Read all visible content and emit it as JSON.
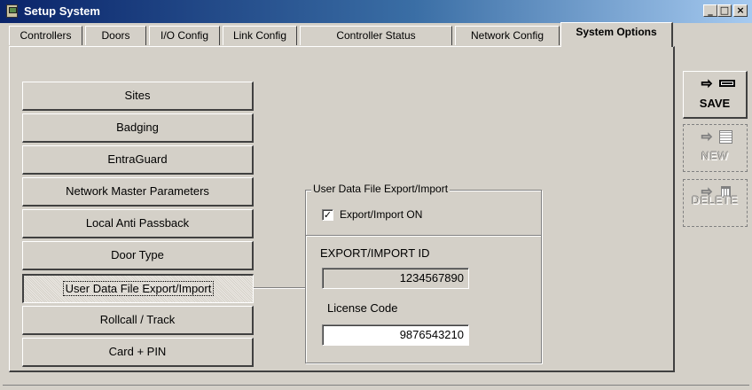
{
  "window": {
    "title": "Setup System",
    "controls": {
      "minimize": "_",
      "maximize": "□",
      "close": "×"
    }
  },
  "tabs": [
    {
      "label": "Controllers",
      "active": false
    },
    {
      "label": "Doors",
      "active": false
    },
    {
      "label": "I/O Config",
      "active": false
    },
    {
      "label": "Link Config",
      "active": false
    },
    {
      "label": "Controller Status",
      "active": false
    },
    {
      "label": "Network Config",
      "active": false
    },
    {
      "label": "System Options",
      "active": true
    }
  ],
  "options": [
    {
      "label": "Sites"
    },
    {
      "label": "Badging"
    },
    {
      "label": "EntraGuard"
    },
    {
      "label": "Network Master Parameters"
    },
    {
      "label": "Local Anti Passback"
    },
    {
      "label": "Door Type"
    },
    {
      "label": "User Data File Export/Import",
      "selected": true
    },
    {
      "label": "Rollcall / Track"
    },
    {
      "label": "Card + PIN"
    }
  ],
  "export_group": {
    "title": "User Data File Export/Import",
    "checkbox_label": "Export/Import ON",
    "checked": true,
    "check_glyph": "✓",
    "id_label": "EXPORT/IMPORT ID",
    "id_value": "1234567890",
    "license_label": "License Code",
    "license_value": "9876543210"
  },
  "side_buttons": {
    "save": {
      "label": "SAVE",
      "enabled": true,
      "icon": "save-icon"
    },
    "new": {
      "label": "NEW",
      "enabled": false,
      "icon": "new-record-icon"
    },
    "delete": {
      "label": "DELETE",
      "enabled": false,
      "icon": "trash-icon"
    },
    "arrow_glyph": "⇨"
  },
  "colors": {
    "titlebar_start": "#0a246a",
    "titlebar_end": "#a6caf0",
    "face": "#d4d0c8"
  }
}
